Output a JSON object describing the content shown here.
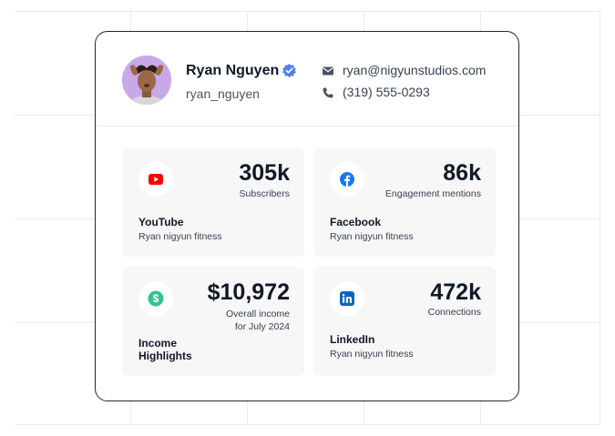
{
  "profile": {
    "name": "Ryan Nguyen",
    "handle": "ryan_nguyen",
    "email": "ryan@nigyunstudios.com",
    "phone": "(319) 555-0293"
  },
  "tiles": {
    "youtube": {
      "stat": "305k",
      "sub": "Subscribers",
      "title": "YouTube",
      "desc": "Ryan nigyun fitness"
    },
    "facebook": {
      "stat": "86k",
      "sub": "Engagement mentions",
      "title": "Facebook",
      "desc": "Ryan nigyun fitness"
    },
    "income": {
      "stat": "$10,972",
      "sub1": "Overall income",
      "sub2": "for July 2024",
      "title1": "Income",
      "title2": "Highlights"
    },
    "linkedin": {
      "stat": "472k",
      "sub": "Connections",
      "title": "LinkedIn",
      "desc": "Ryan nigyun fitness"
    }
  },
  "colors": {
    "youtube": "#ff0000",
    "facebook": "#1877f2",
    "income": "#34c38f",
    "linkedin": "#0a66c2",
    "verified": "#4f7df3"
  }
}
